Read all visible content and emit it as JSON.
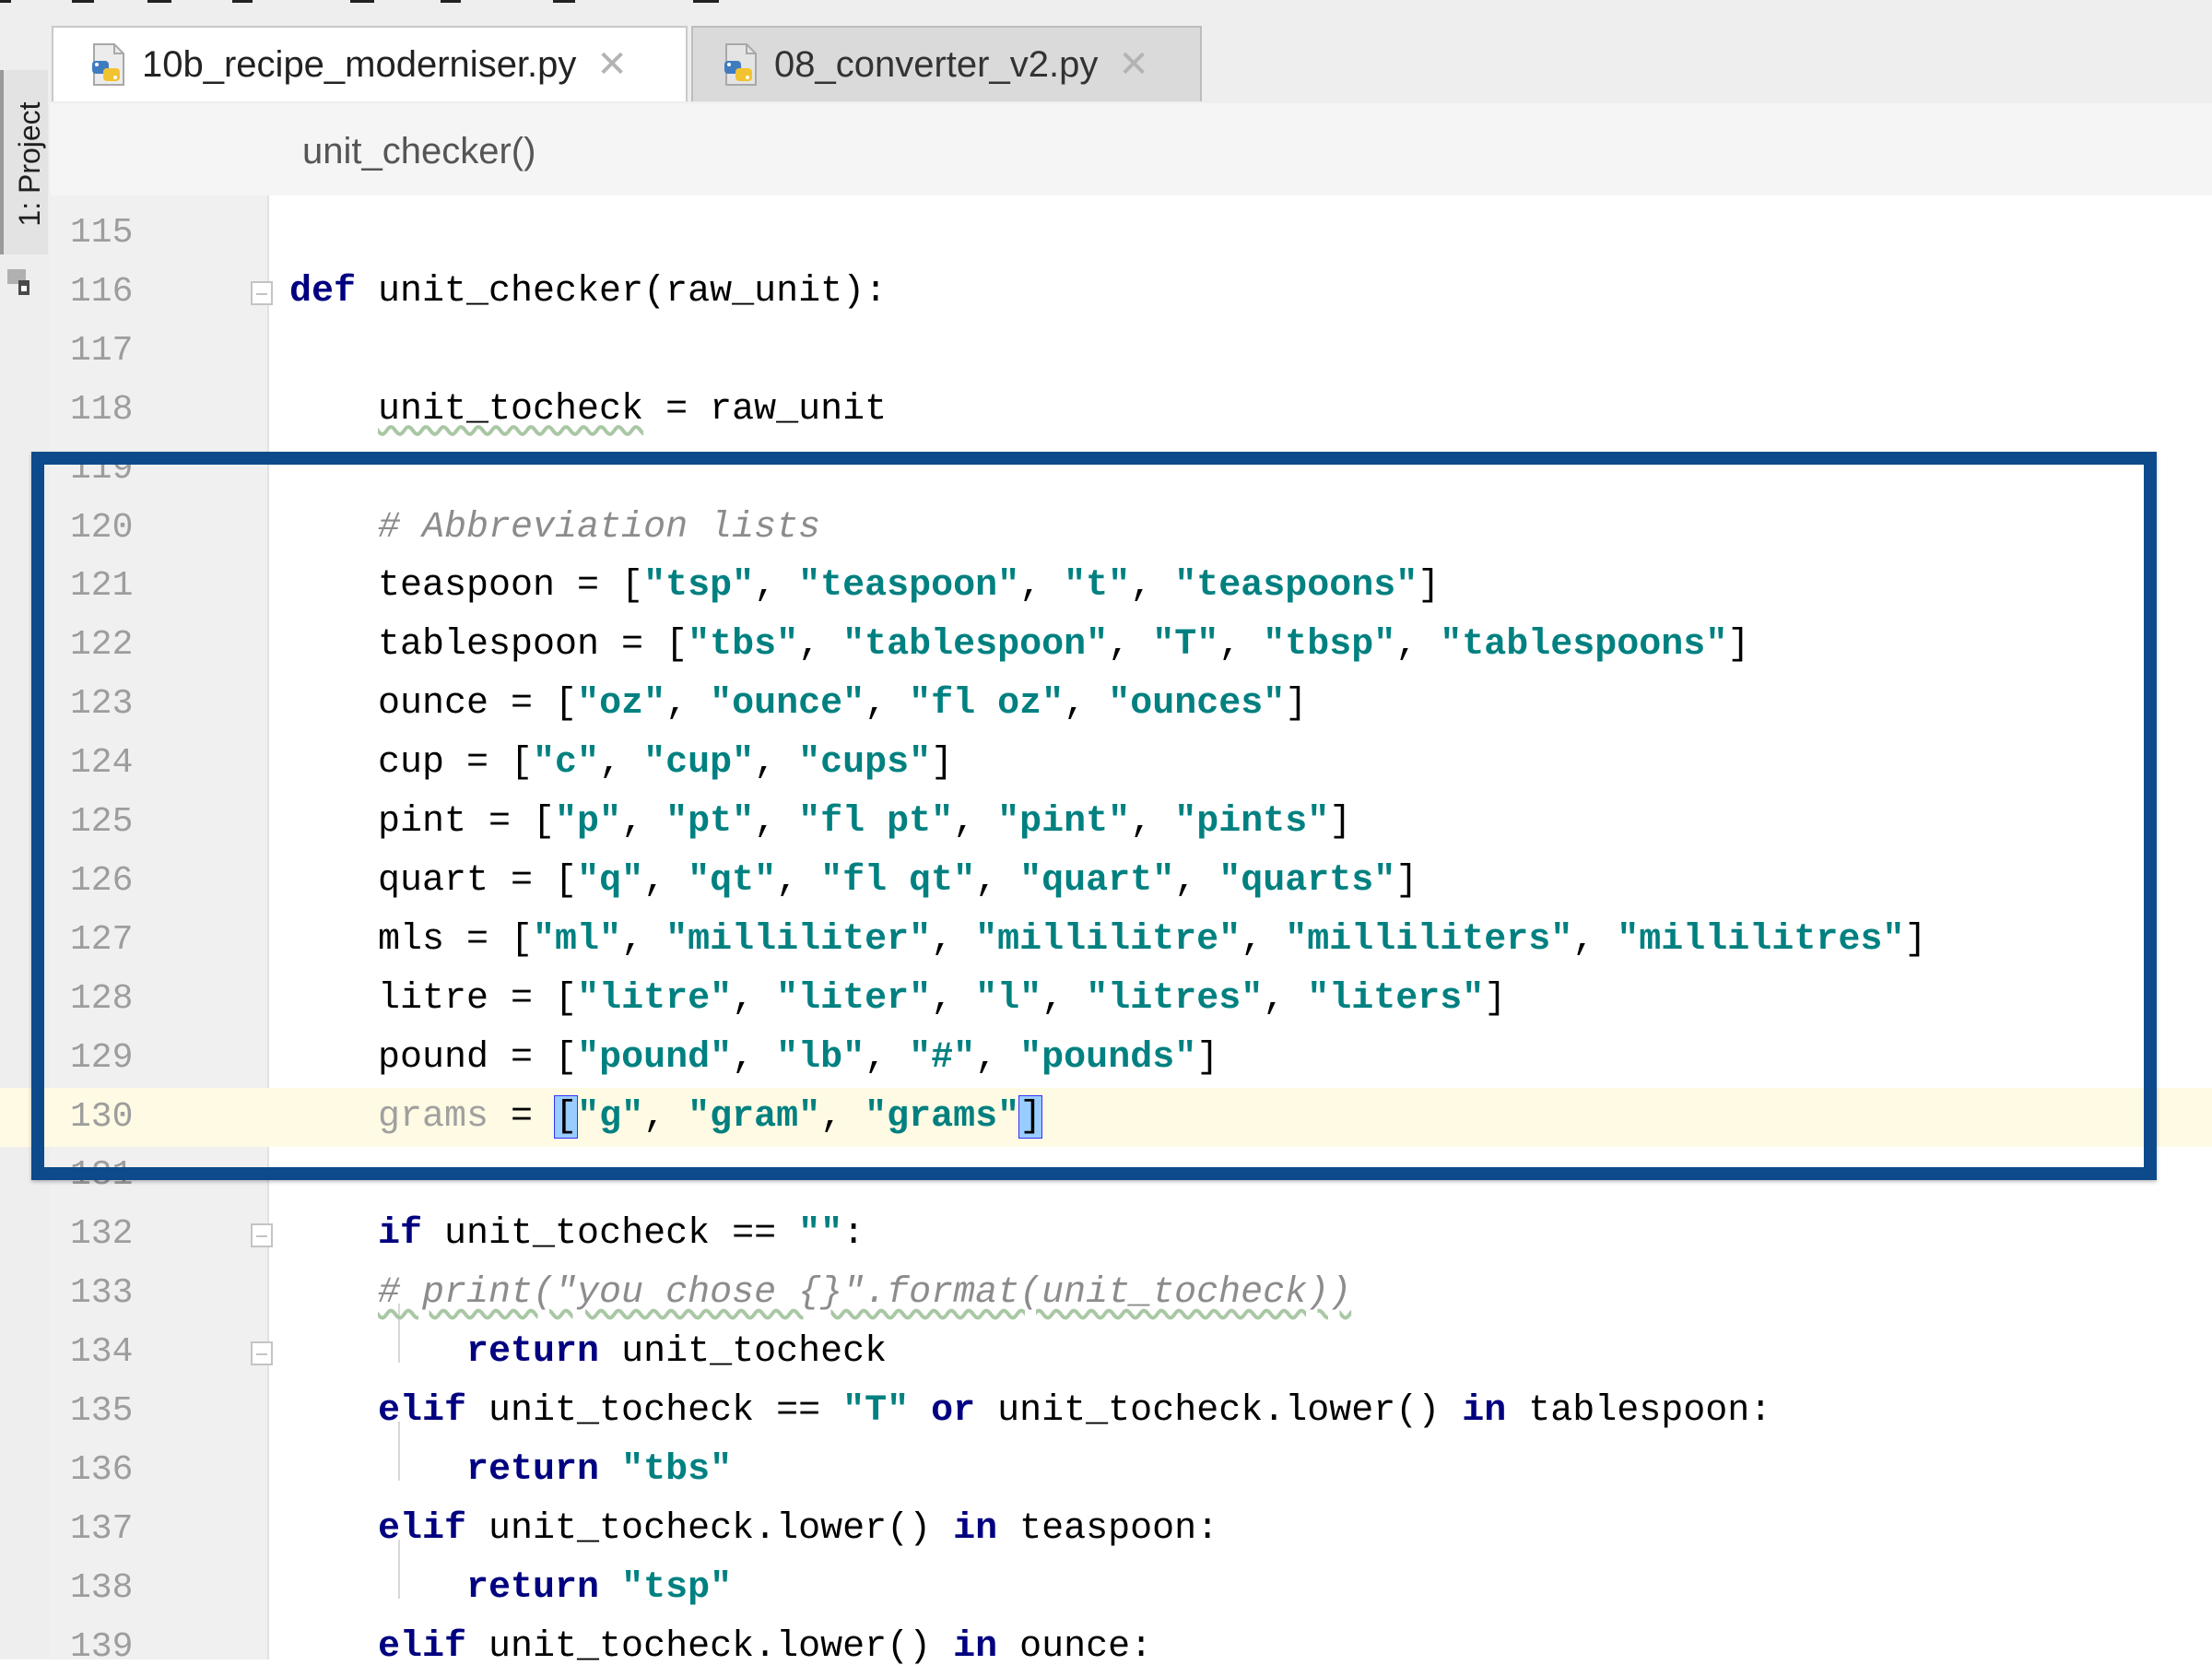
{
  "tabs": [
    {
      "label": "10b_recipe_moderniser.py",
      "active": true,
      "icon": "python-file-icon"
    },
    {
      "label": "08_converter_v2.py",
      "active": false,
      "icon": "python-file-icon"
    }
  ],
  "tab_close_glyph": "✕",
  "tool_window": {
    "label": "1: Project"
  },
  "breadcrumb": "unit_checker()",
  "colors": {
    "keyword": "#000080",
    "string": "#008080",
    "comment": "#8c8c8c",
    "line_number": "#9d9d9d",
    "current_line": "#fffae3",
    "highlight_box": "#0d4a8c",
    "bracket_match": "#99ccff"
  },
  "lines": [
    {
      "n": "115",
      "tokens": []
    },
    {
      "n": "116",
      "fold": true,
      "tokens": [
        {
          "t": "def",
          "c": "kw"
        },
        {
          "t": " unit_checker(raw_unit):"
        }
      ]
    },
    {
      "n": "117",
      "tokens": []
    },
    {
      "n": "118",
      "tokens": [
        {
          "t": "    "
        },
        {
          "t": "unit_tocheck",
          "c": "wavy"
        },
        {
          "t": " = raw_unit"
        }
      ]
    },
    {
      "n": "119",
      "tokens": []
    },
    {
      "n": "120",
      "tokens": [
        {
          "t": "    "
        },
        {
          "t": "# Abbreviation lists",
          "c": "cmt"
        }
      ]
    },
    {
      "n": "121",
      "tokens": [
        {
          "t": "    teaspoon = ["
        },
        {
          "t": "\"tsp\"",
          "c": "str"
        },
        {
          "t": ", "
        },
        {
          "t": "\"teaspoon\"",
          "c": "str"
        },
        {
          "t": ", "
        },
        {
          "t": "\"t\"",
          "c": "str"
        },
        {
          "t": ", "
        },
        {
          "t": "\"teaspoons\"",
          "c": "str"
        },
        {
          "t": "]"
        }
      ]
    },
    {
      "n": "122",
      "tokens": [
        {
          "t": "    tablespoon = ["
        },
        {
          "t": "\"tbs\"",
          "c": "str"
        },
        {
          "t": ", "
        },
        {
          "t": "\"tablespoon\"",
          "c": "str"
        },
        {
          "t": ", "
        },
        {
          "t": "\"T\"",
          "c": "str"
        },
        {
          "t": ", "
        },
        {
          "t": "\"tbsp\"",
          "c": "str"
        },
        {
          "t": ", "
        },
        {
          "t": "\"tablespoons\"",
          "c": "str"
        },
        {
          "t": "]"
        }
      ]
    },
    {
      "n": "123",
      "tokens": [
        {
          "t": "    ounce = ["
        },
        {
          "t": "\"oz\"",
          "c": "str"
        },
        {
          "t": ", "
        },
        {
          "t": "\"ounce\"",
          "c": "str"
        },
        {
          "t": ", "
        },
        {
          "t": "\"fl oz\"",
          "c": "str"
        },
        {
          "t": ", "
        },
        {
          "t": "\"ounces\"",
          "c": "str"
        },
        {
          "t": "]"
        }
      ]
    },
    {
      "n": "124",
      "tokens": [
        {
          "t": "    cup = ["
        },
        {
          "t": "\"c\"",
          "c": "str"
        },
        {
          "t": ", "
        },
        {
          "t": "\"cup\"",
          "c": "str"
        },
        {
          "t": ", "
        },
        {
          "t": "\"cups\"",
          "c": "str"
        },
        {
          "t": "]"
        }
      ]
    },
    {
      "n": "125",
      "tokens": [
        {
          "t": "    pint = ["
        },
        {
          "t": "\"p\"",
          "c": "str"
        },
        {
          "t": ", "
        },
        {
          "t": "\"pt\"",
          "c": "str"
        },
        {
          "t": ", "
        },
        {
          "t": "\"fl pt\"",
          "c": "str"
        },
        {
          "t": ", "
        },
        {
          "t": "\"pint\"",
          "c": "str"
        },
        {
          "t": ", "
        },
        {
          "t": "\"pints\"",
          "c": "str"
        },
        {
          "t": "]"
        }
      ]
    },
    {
      "n": "126",
      "tokens": [
        {
          "t": "    quart = ["
        },
        {
          "t": "\"q\"",
          "c": "str"
        },
        {
          "t": ", "
        },
        {
          "t": "\"qt\"",
          "c": "str"
        },
        {
          "t": ", "
        },
        {
          "t": "\"fl qt\"",
          "c": "str"
        },
        {
          "t": ", "
        },
        {
          "t": "\"quart\"",
          "c": "str"
        },
        {
          "t": ", "
        },
        {
          "t": "\"quarts\"",
          "c": "str"
        },
        {
          "t": "]"
        }
      ]
    },
    {
      "n": "127",
      "tokens": [
        {
          "t": "    mls = ["
        },
        {
          "t": "\"ml\"",
          "c": "str"
        },
        {
          "t": ", "
        },
        {
          "t": "\"milliliter\"",
          "c": "str"
        },
        {
          "t": ", "
        },
        {
          "t": "\"millilitre\"",
          "c": "str"
        },
        {
          "t": ", "
        },
        {
          "t": "\"milliliters\"",
          "c": "str"
        },
        {
          "t": ", "
        },
        {
          "t": "\"millilitres\"",
          "c": "str"
        },
        {
          "t": "]"
        }
      ]
    },
    {
      "n": "128",
      "tokens": [
        {
          "t": "    litre = ["
        },
        {
          "t": "\"litre\"",
          "c": "str"
        },
        {
          "t": ", "
        },
        {
          "t": "\"liter\"",
          "c": "str"
        },
        {
          "t": ", "
        },
        {
          "t": "\"l\"",
          "c": "str"
        },
        {
          "t": ", "
        },
        {
          "t": "\"litres\"",
          "c": "str"
        },
        {
          "t": ", "
        },
        {
          "t": "\"liters\"",
          "c": "str"
        },
        {
          "t": "]"
        }
      ]
    },
    {
      "n": "129",
      "tokens": [
        {
          "t": "    pound = ["
        },
        {
          "t": "\"pound\"",
          "c": "str"
        },
        {
          "t": ", "
        },
        {
          "t": "\"lb\"",
          "c": "str"
        },
        {
          "t": ", "
        },
        {
          "t": "\"#\"",
          "c": "str"
        },
        {
          "t": ", "
        },
        {
          "t": "\"pounds\"",
          "c": "str"
        },
        {
          "t": "]"
        }
      ]
    },
    {
      "n": "130",
      "current": true,
      "tokens": [
        {
          "t": "    "
        },
        {
          "t": "grams",
          "c": "dim"
        },
        {
          "t": " = "
        },
        {
          "t": "[",
          "c": "br"
        },
        {
          "t": "\"g\"",
          "c": "str"
        },
        {
          "t": ", "
        },
        {
          "t": "\"gram\"",
          "c": "str"
        },
        {
          "t": ", "
        },
        {
          "t": "\"grams\"",
          "c": "str"
        },
        {
          "t": "]",
          "c": "br"
        }
      ]
    },
    {
      "n": "131",
      "tokens": []
    },
    {
      "n": "132",
      "fold": true,
      "tokens": [
        {
          "t": "    "
        },
        {
          "t": "if",
          "c": "kw"
        },
        {
          "t": " unit_tocheck == "
        },
        {
          "t": "\"\"",
          "c": "str"
        },
        {
          "t": ":"
        }
      ]
    },
    {
      "n": "133",
      "tokens": [
        {
          "t": "    "
        },
        {
          "t": "# print(\"you chose {}\".format(unit_tocheck))",
          "c": "cmt wavy"
        }
      ]
    },
    {
      "n": "134",
      "fold": true,
      "tokens": [
        {
          "t": "        "
        },
        {
          "t": "return",
          "c": "kw"
        },
        {
          "t": " unit_tocheck"
        }
      ]
    },
    {
      "n": "135",
      "tokens": [
        {
          "t": "    "
        },
        {
          "t": "elif",
          "c": "kw"
        },
        {
          "t": " unit_tocheck == "
        },
        {
          "t": "\"T\"",
          "c": "str"
        },
        {
          "t": " "
        },
        {
          "t": "or",
          "c": "kw"
        },
        {
          "t": " unit_tocheck.lower() "
        },
        {
          "t": "in",
          "c": "kw"
        },
        {
          "t": " tablespoon:"
        }
      ]
    },
    {
      "n": "136",
      "tokens": [
        {
          "t": "        "
        },
        {
          "t": "return",
          "c": "kw"
        },
        {
          "t": " "
        },
        {
          "t": "\"tbs\"",
          "c": "str"
        }
      ]
    },
    {
      "n": "137",
      "tokens": [
        {
          "t": "    "
        },
        {
          "t": "elif",
          "c": "kw"
        },
        {
          "t": " unit_tocheck.lower() "
        },
        {
          "t": "in",
          "c": "kw"
        },
        {
          "t": " teaspoon:"
        }
      ]
    },
    {
      "n": "138",
      "tokens": [
        {
          "t": "        "
        },
        {
          "t": "return",
          "c": "kw"
        },
        {
          "t": " "
        },
        {
          "t": "\"tsp\"",
          "c": "str"
        }
      ]
    },
    {
      "n": "139",
      "tokens": [
        {
          "t": "    "
        },
        {
          "t": "elif",
          "c": "kw"
        },
        {
          "t": " unit_tocheck.lower() "
        },
        {
          "t": "in",
          "c": "kw"
        },
        {
          "t": " ounce:"
        }
      ]
    }
  ]
}
